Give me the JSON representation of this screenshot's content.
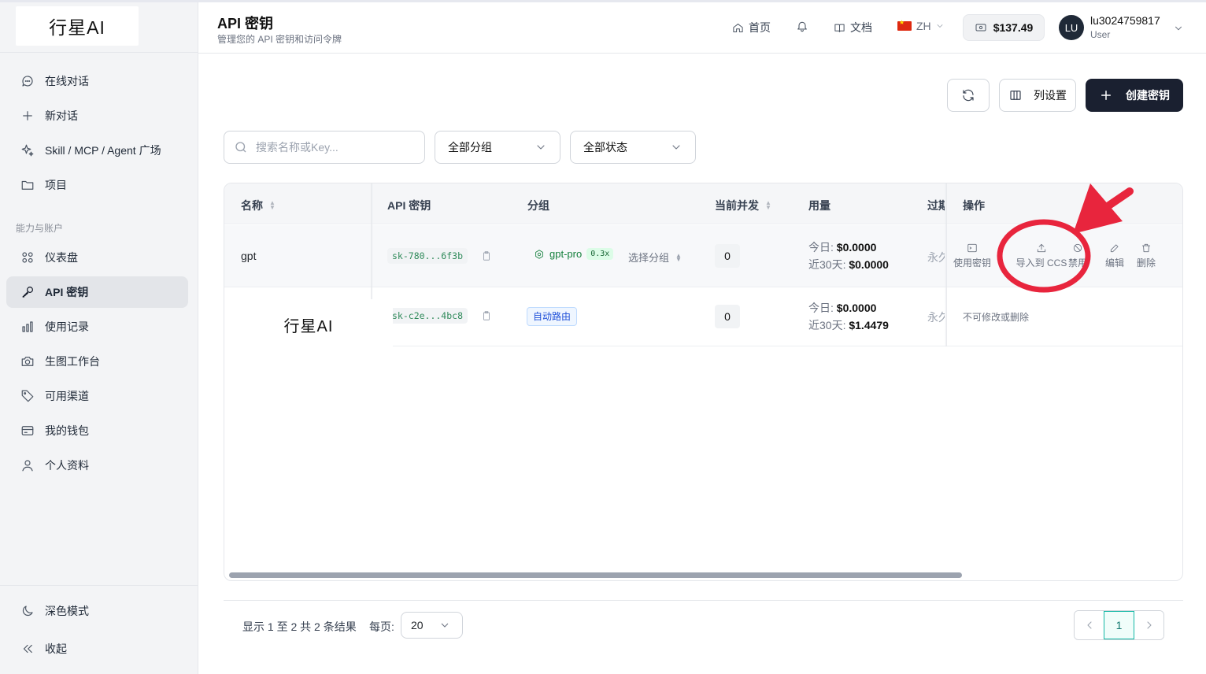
{
  "brand": {
    "logo_text": "行星AI"
  },
  "sidebar": {
    "items": [
      {
        "label": "在线对话",
        "icon": "chat-icon"
      },
      {
        "label": "新对话",
        "icon": "plus-icon"
      },
      {
        "label": "Skill / MCP / Agent 广场",
        "icon": "sparkle-icon"
      },
      {
        "label": "项目",
        "icon": "folder-icon"
      }
    ],
    "section_label": "能力与账户",
    "account_items": [
      {
        "label": "仪表盘",
        "icon": "dashboard-icon"
      },
      {
        "label": "API 密钥",
        "icon": "key-icon",
        "active": true
      },
      {
        "label": "使用记录",
        "icon": "bar-chart-icon"
      },
      {
        "label": "生图工作台",
        "icon": "camera-icon"
      },
      {
        "label": "可用渠道",
        "icon": "tag-icon"
      },
      {
        "label": "我的钱包",
        "icon": "wallet-icon"
      },
      {
        "label": "个人资料",
        "icon": "user-icon"
      }
    ],
    "dark_mode_label": "深色模式",
    "collapse_label": "收起"
  },
  "header": {
    "title": "API 密钥",
    "subtitle": "管理您的 API 密钥和访问令牌",
    "home_label": "首页",
    "docs_label": "文档",
    "lang_label": "ZH",
    "balance": "$137.49",
    "avatar_initials": "LU",
    "user_name": "lu3024759817",
    "user_role": "User"
  },
  "toolbar": {
    "column_settings_label": "列设置",
    "create_key_label": "创建密钥"
  },
  "filters": {
    "search_placeholder": "搜索名称或Key...",
    "group_select": "全部分组",
    "status_select": "全部状态"
  },
  "table": {
    "headers": {
      "name": "名称",
      "api_key": "API 密钥",
      "group": "分组",
      "concurrency": "当前并发",
      "usage": "用量",
      "expires": "过期",
      "actions": "操作"
    },
    "rows": [
      {
        "name": "gpt",
        "key": "sk-780...6f3b",
        "group": "gpt-pro",
        "ratio": "0.3x",
        "select_group": "选择分组",
        "concurrency": "0",
        "today_label": "今日:",
        "today": "$0.0000",
        "month_label": "近30天:",
        "month": "$0.0000",
        "expires": "永久"
      },
      {
        "name": "",
        "key": "sk-c2e...4bc8",
        "group": "自动路由",
        "concurrency": "0",
        "today_label": "今日:",
        "today": "$0.0000",
        "month_label": "近30天:",
        "month": "$1.4479",
        "expires": "永久",
        "actions_note": "不可修改或删除"
      }
    ],
    "actions": {
      "use_key": "使用密钥",
      "import_ccs": "导入到 CCS",
      "disable": "禁用",
      "edit": "编辑",
      "delete": "删除"
    }
  },
  "watermark": {
    "text": "行星AI"
  },
  "footer": {
    "result_text": "显示 1 至 2 共 2 条结果",
    "per_page_label": "每页:",
    "per_page_value": "20",
    "current_page": "1"
  },
  "colors": {
    "primary_button": "#1a2030",
    "annotation": "#e8253d",
    "key_text": "#2f8a5a",
    "pager_accent": "#14b8a6"
  }
}
